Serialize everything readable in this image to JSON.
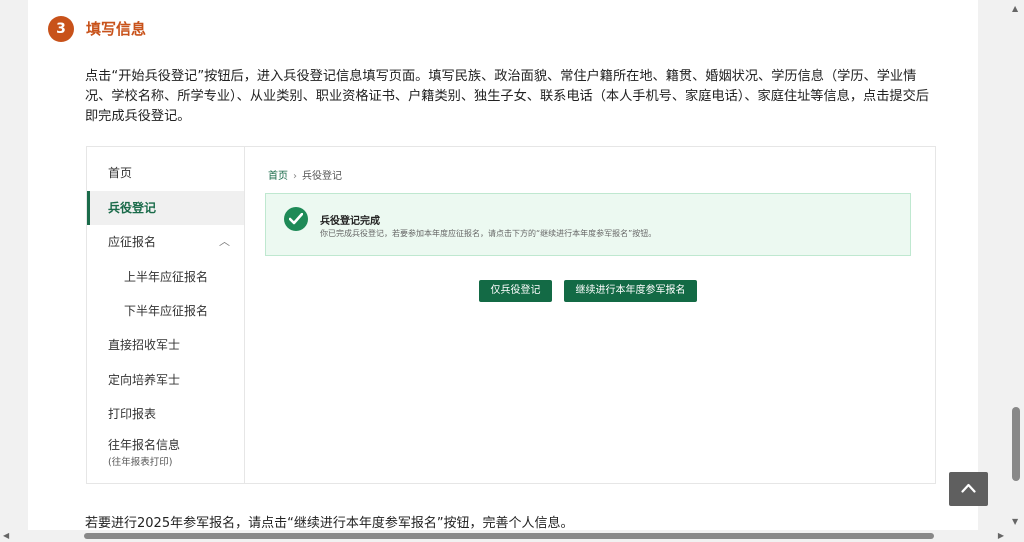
{
  "step": {
    "number": "3",
    "title": "填写信息"
  },
  "intro_text": "点击“开始兵役登记”按钮后，进入兵役登记信息填写页面。填写民族、政治面貌、常住户籍所在地、籍贯、婚姻状况、学历信息（学历、学业情况、学校名称、所学专业）、从业类别、职业资格证书、户籍类别、独生子女、联系电话（本人手机号、家庭电话）、家庭住址等信息，点击提交后即完成兵役登记。",
  "sidebar": {
    "items": [
      {
        "label": "首页"
      },
      {
        "label": "兵役登记"
      },
      {
        "label": "应征报名"
      },
      {
        "label": "上半年应征报名"
      },
      {
        "label": "下半年应征报名"
      },
      {
        "label": "直接招收军士"
      },
      {
        "label": "定向培养军士"
      },
      {
        "label": "打印报表"
      },
      {
        "label": "往年报名信息",
        "sub": "(往年报表打印)"
      }
    ]
  },
  "breadcrumb": {
    "home": "首页",
    "current": "兵役登记"
  },
  "success": {
    "title": "兵役登记完成",
    "desc": "你已完成兵役登记，若要参加本年度应征报名，请点击下方的“继续进行本年度参军报名”按钮。"
  },
  "buttons": {
    "only_register": "仅兵役登记",
    "continue": "继续进行本年度参军报名"
  },
  "outro_text": "若要进行2025年参军报名，请点击“继续进行本年度参军报名”按钮，完善个人信息。",
  "colors": {
    "accent": "#c8521a",
    "brand_green": "#136a45",
    "success_bg": "#ecf9f1"
  }
}
